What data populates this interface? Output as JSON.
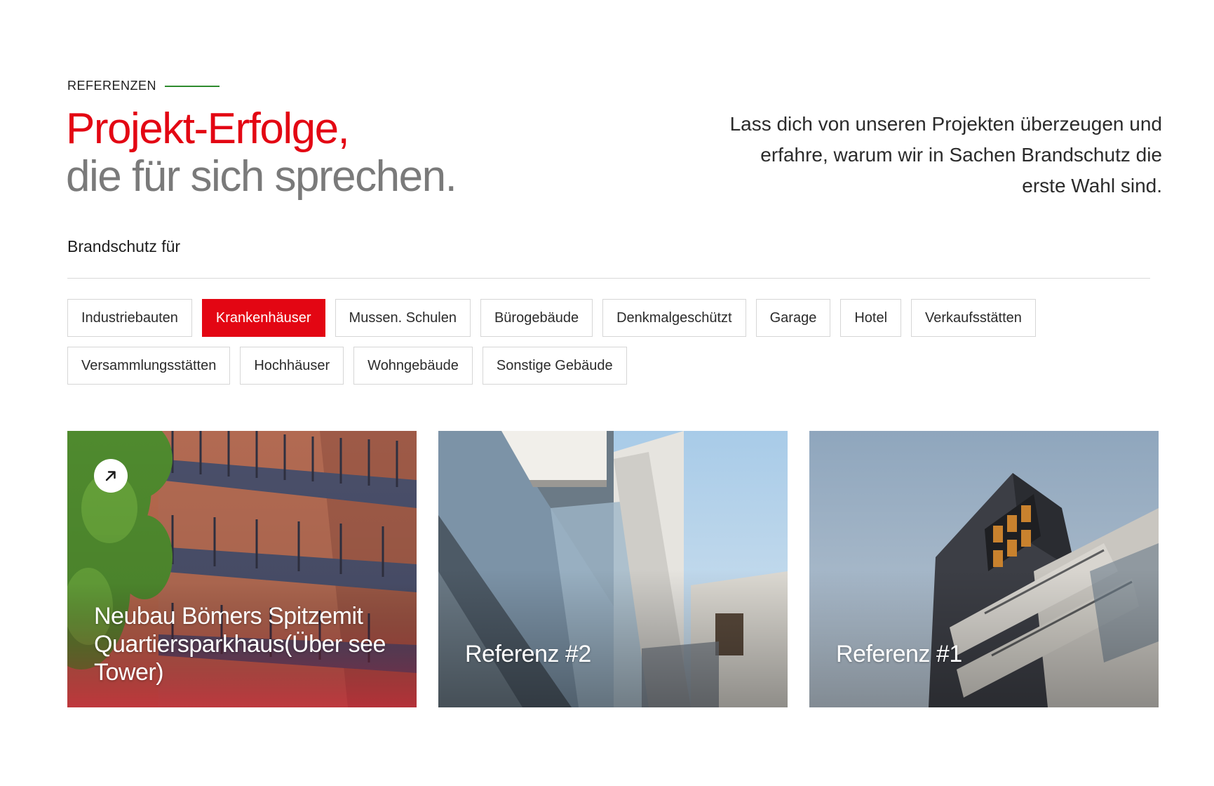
{
  "header": {
    "eyebrow": "REFERENZEN",
    "title_line1": "Projekt-Erfolge,",
    "title_line2": "die für sich sprechen.",
    "intro": "Lass dich von unseren Projekten überzeugen und erfahre, warum wir in Sachen Brandschutz die erste Wahl sind."
  },
  "filter": {
    "label": "Brandschutz für",
    "items": [
      {
        "label": "Industriebauten",
        "active": false
      },
      {
        "label": "Krankenhäuser",
        "active": true
      },
      {
        "label": "Mussen. Schulen",
        "active": false
      },
      {
        "label": "Bürogebäude",
        "active": false
      },
      {
        "label": "Denkmalgeschützt",
        "active": false
      },
      {
        "label": "Garage",
        "active": false
      },
      {
        "label": "Hotel",
        "active": false
      },
      {
        "label": "Verkaufsstätten",
        "active": false
      },
      {
        "label": "Versammlungsstätten",
        "active": false
      },
      {
        "label": "Hochhäuser",
        "active": false
      },
      {
        "label": "Wohngebäude",
        "active": false
      },
      {
        "label": "Sonstige Gebäude",
        "active": false
      }
    ]
  },
  "cards": [
    {
      "title": "Neubau Bömers Spitzemit Quartiersparkhaus(Über see Tower)",
      "icon": "arrow-up-right-icon"
    },
    {
      "title": "Referenz #2"
    },
    {
      "title": "Referenz #1"
    }
  ],
  "colors": {
    "accent": "#e30613",
    "eyebrow_line": "#2e8b2e",
    "title_secondary": "#7a7a7a"
  }
}
